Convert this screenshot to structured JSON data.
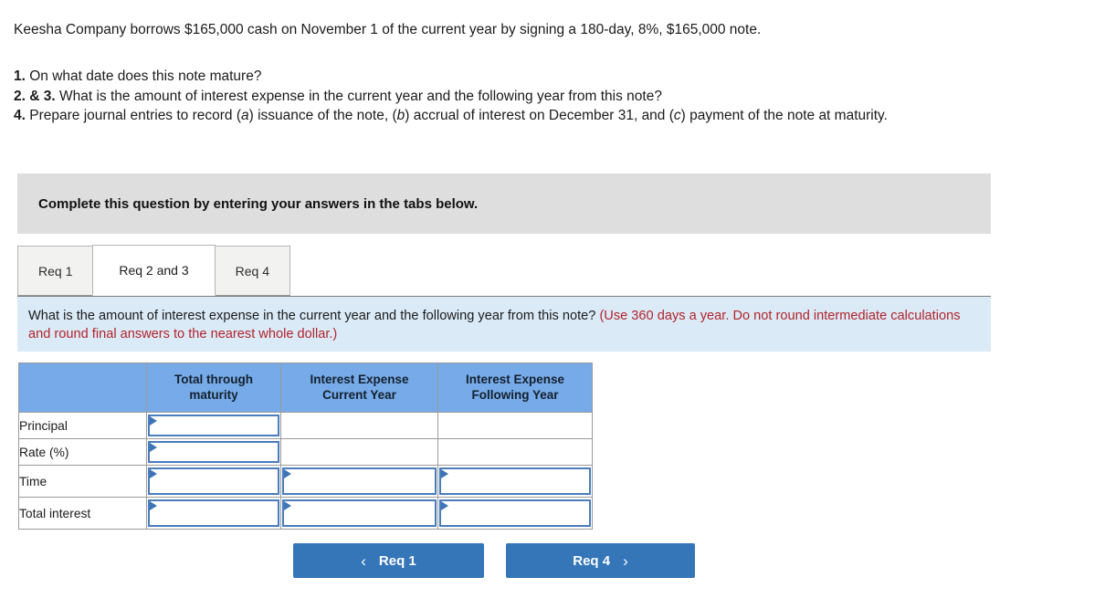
{
  "problem": {
    "stem": "Keesha Company borrows $165,000 cash on November 1 of the current year by signing a 180-day, 8%, $165,000 note.",
    "requirements": [
      {
        "num": "1.",
        "text": "On what date does this note mature?"
      },
      {
        "num": "2. & 3.",
        "text": "What is the amount of interest expense in the current year and the following year from this note?"
      },
      {
        "num": "4.",
        "text_parts": [
          "Prepare journal entries to record (",
          "a",
          ") issuance of the note, (",
          "b",
          ") accrual of interest on December 31, and (",
          "c",
          ") payment of the note at maturity."
        ]
      }
    ]
  },
  "banner": {
    "text": "Complete this question by entering your answers in the tabs below."
  },
  "tabs": [
    {
      "label": "Req 1",
      "active": false
    },
    {
      "label": "Req 2 and 3",
      "active": true
    },
    {
      "label": "Req 4",
      "active": false
    }
  ],
  "requirement_panel": {
    "question": "What is the amount of interest expense in the current year and the following year from this note? ",
    "hint": "(Use 360 days a year. Do not round intermediate calculations and round final answers to the nearest whole dollar.)"
  },
  "table": {
    "headers": [
      "",
      "Total through maturity",
      "Interest Expense Current Year",
      "Interest Expense Following Year"
    ],
    "header_lines": [
      [
        "",
        ""
      ],
      [
        "Total through",
        "maturity"
      ],
      [
        "Interest Expense",
        "Current Year"
      ],
      [
        "Interest Expense",
        "Following Year"
      ]
    ],
    "rows": [
      {
        "label": "Principal",
        "cells": [
          {
            "input": true,
            "value": ""
          },
          {
            "input": false,
            "value": ""
          },
          {
            "input": false,
            "value": ""
          }
        ]
      },
      {
        "label": "Rate (%)",
        "cells": [
          {
            "input": true,
            "value": ""
          },
          {
            "input": false,
            "value": ""
          },
          {
            "input": false,
            "value": ""
          }
        ]
      },
      {
        "label": "Time",
        "cells": [
          {
            "input": true,
            "value": ""
          },
          {
            "input": true,
            "value": ""
          },
          {
            "input": true,
            "value": ""
          }
        ]
      },
      {
        "label": "Total interest",
        "cells": [
          {
            "input": true,
            "value": ""
          },
          {
            "input": true,
            "value": ""
          },
          {
            "input": true,
            "value": ""
          }
        ]
      }
    ]
  },
  "navigation": {
    "prev_label": "Req 1",
    "next_label": "Req 4",
    "prev_icon": "chevron-left-icon",
    "next_icon": "chevron-right-icon",
    "prev_chevron": "‹",
    "next_chevron": "›"
  },
  "colors": {
    "button_blue": "#3576b9",
    "table_header_blue": "#76aae8",
    "panel_light_blue": "#daeaf7",
    "banner_gray": "#dedede",
    "hint_red": "#b4232b",
    "input_border_blue": "#4a7dba"
  }
}
